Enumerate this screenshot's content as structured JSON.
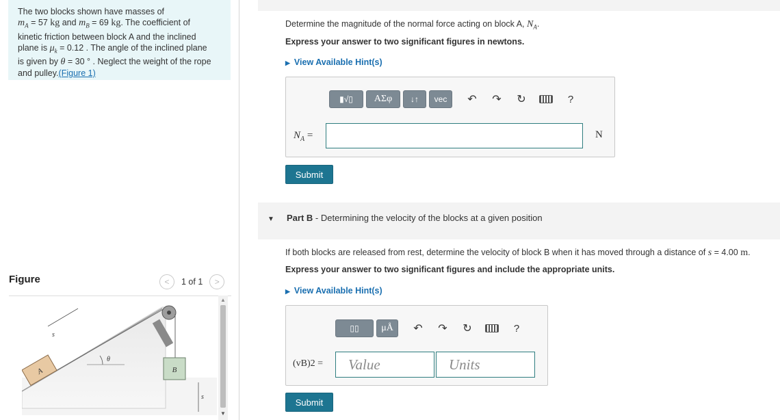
{
  "problem": {
    "line1": "The two blocks shown have masses of",
    "mA_sym": "m",
    "mA_sub": "A",
    "mA_val": " = 57 ",
    "kg": "kg",
    "and": " and ",
    "mB_sym": "m",
    "mB_sub": "B",
    "mB_val": " = 69 ",
    "kg2": "kg",
    "line2_end": ". The coefficient of",
    "line3": "kinetic friction between block A and the inclined",
    "line4_start": "plane is ",
    "mu_sym": "μ",
    "mu_sub": "k",
    "line4_end": " = 0.12 . The angle of the inclined plane",
    "line5_start": "is given by ",
    "theta_sym": "θ",
    "line5_end": " = 30 ° . Neglect the weight of the rope",
    "line6_start": "and pulley.",
    "figure_link": "(Figure 1)"
  },
  "figure": {
    "title": "Figure",
    "pager_text": "1 of 1",
    "prev": "<",
    "next": ">",
    "labels": {
      "block_a": "A",
      "block_b": "B",
      "s_left": "s",
      "s_right": "s",
      "theta": "θ"
    }
  },
  "scroll": {
    "up": "▲",
    "down": "▼"
  },
  "partA": {
    "question_start": "Determine the magnitude of the normal force acting on block A, ",
    "question_sym": "N",
    "question_sub": "A",
    "question_end": ".",
    "express": "Express your answer to two significant figures in newtons.",
    "hints_caret": "▶",
    "hints": "View Available Hint(s)",
    "toolbar": {
      "templates": "▮√▯",
      "greek": "ΑΣφ",
      "updown": "↓↑",
      "vec": "vec",
      "undo": "↶",
      "redo": "↷",
      "reset": "↻",
      "help": "?"
    },
    "input_label_sym": "N",
    "input_label_sub": "A",
    "input_label_eq": " =",
    "unit": "N",
    "submit": "Submit"
  },
  "partB": {
    "caret": "▼",
    "title_bold": "Part B",
    "title_rest": " - Determining the velocity of the blocks at a given position",
    "question_start": "If both blocks are released from rest, determine the velocity of block B when it has moved through a distance of ",
    "s_sym": "s",
    "s_val": " = 4.00 ",
    "m": "m",
    "question_end": ".",
    "express": "Express your answer to two significant figures and include the appropriate units.",
    "hints_caret": "▶",
    "hints": "View Available Hint(s)",
    "toolbar": {
      "templates": "▯▯",
      "units": "μÅ",
      "undo": "↶",
      "redo": "↷",
      "reset": "↻",
      "help": "?"
    },
    "label": "(vB)2 =",
    "value_placeholder": "Value",
    "units_placeholder": "Units",
    "submit": "Submit"
  }
}
